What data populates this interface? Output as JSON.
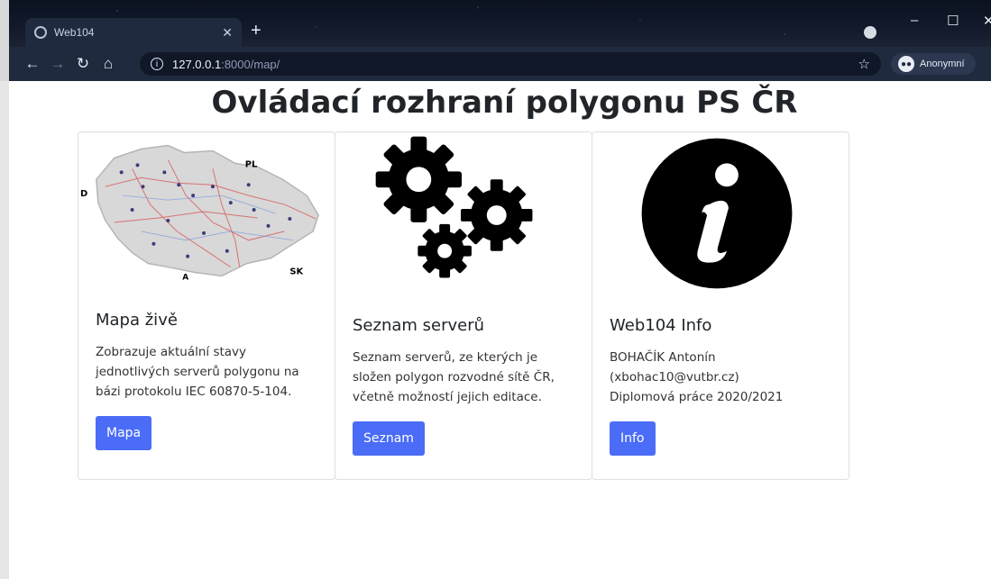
{
  "browser": {
    "tab_title": "Web104",
    "url_host": "127.0.0.1",
    "url_path": ":8000/map/",
    "incognito_label": "Anonymní"
  },
  "page": {
    "title": "Ovládací rozhraní polygonu PS ČR"
  },
  "cards": [
    {
      "map_labels": [
        "PL",
        "D",
        "A",
        "SK"
      ],
      "title": "Mapa živě",
      "text": "Zobrazuje aktuální stavy jednotlivých serverů polygonu na bázi protokolu IEC 60870-5-104.",
      "button": "Mapa"
    },
    {
      "title": "Seznam serverů",
      "text": "Seznam serverů, ze kterých je složen polygon rozvodné sítě ČR, včetně možností jejich editace.",
      "button": "Seznam"
    },
    {
      "title": "Web104 Info",
      "text_lines": [
        "BOHAČÍK Antonín",
        "(xbohac10@vutbr.cz)",
        "Diplomová práce 2020/2021"
      ],
      "button": "Info"
    }
  ],
  "colors": {
    "primary_button": "#4a6cf7",
    "chrome": "#202a3e"
  }
}
